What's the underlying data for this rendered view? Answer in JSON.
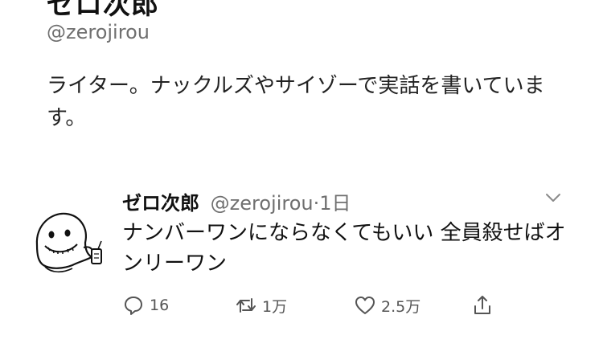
{
  "profile": {
    "name": "ゼロ次郎",
    "handle": "@zerojirou",
    "bio": "ライター。ナックルズやサイゾーで実話を書いています。"
  },
  "tweet": {
    "author": "ゼロ次郎",
    "handle": "@zerojirou",
    "separator": "·",
    "time": "1日",
    "text": "ナンバーワンにならなくてもいい 全員殺せばオンリーワン",
    "actions": {
      "reply_icon": "reply-icon",
      "reply_count": "16",
      "retweet_icon": "retweet-icon",
      "retweet_count": "1万",
      "like_icon": "heart-icon",
      "like_count": "2.5万",
      "share_icon": "share-icon"
    },
    "menu_icon": "chevron-down-icon",
    "avatar_icon": "ghost-mascot-avatar"
  }
}
